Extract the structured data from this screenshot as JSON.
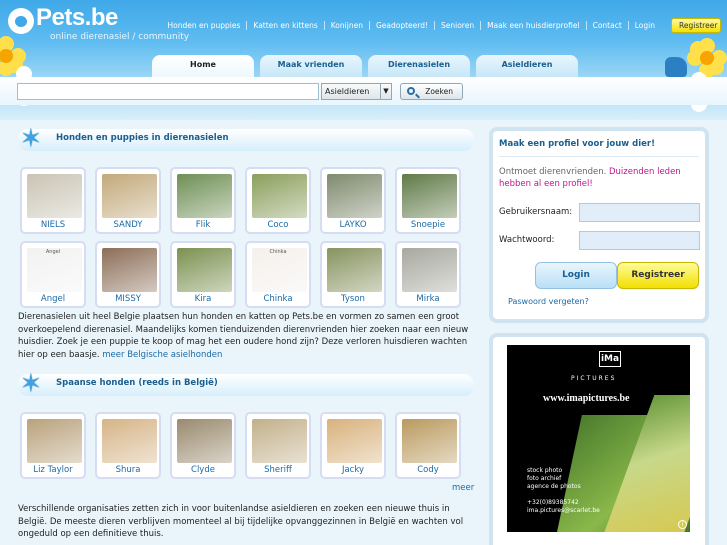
{
  "brand": {
    "name": "Pets.be",
    "tagline": "online dierenasiel / community"
  },
  "topnav": {
    "links": [
      "Honden en puppies",
      "Katten en kittens",
      "Konijnen",
      "Geadopteerd!",
      "Senioren",
      "Maak een huisdierprofiel",
      "Contact",
      "Login"
    ],
    "register_label": "Registreer"
  },
  "tabs": [
    "Home",
    "Maak vrienden",
    "Dierenasielen",
    "Asieldieren"
  ],
  "search": {
    "value": "",
    "select_value": "Asieldieren",
    "button_label": "Zoeken"
  },
  "section1": {
    "title": "Honden en puppies in dierenasielen",
    "animals": [
      {
        "name": "NIELS",
        "color": "#c9c4b4"
      },
      {
        "name": "SANDY",
        "color": "#c2a97a"
      },
      {
        "name": "Flik",
        "color": "#6f8f55"
      },
      {
        "name": "Coco",
        "color": "#8a9f5c"
      },
      {
        "name": "LAYKO",
        "color": "#7f8a6e"
      },
      {
        "name": "Snoepie",
        "color": "#5f7a47"
      },
      {
        "name": "Angel",
        "color": "#f2f2f2"
      },
      {
        "name": "MISSY",
        "color": "#8c6e58"
      },
      {
        "name": "Kira",
        "color": "#7b9150"
      },
      {
        "name": "Chinka",
        "color": "#f4f0ec"
      },
      {
        "name": "Tyson",
        "color": "#87935f"
      },
      {
        "name": "Mirka",
        "color": "#a8a8a0"
      }
    ],
    "caption_angel": "Angel",
    "caption_chinka": "Chinka",
    "paragraph": "Dierenasielen uit heel Belgie plaatsen hun honden en katten op Pets.be en vormen zo samen een groot overkoepelend dierenasiel. Maandelijks komen tienduizenden dierenvrienden hier zoeken naar een nieuw huisdier. Zoek je een puppie te koop of mag het een oudere hond zijn? Deze verloren huisdieren wachten hier op een baasje.",
    "more_link": "meer Belgische asielhonden"
  },
  "section2": {
    "title": "Spaanse honden (reeds in België)",
    "animals": [
      {
        "name": "Liz Taylor",
        "color": "#b9a27c"
      },
      {
        "name": "Shura",
        "color": "#d6b486"
      },
      {
        "name": "Clyde",
        "color": "#9a8a6e"
      },
      {
        "name": "Sheriff",
        "color": "#c2b08a"
      },
      {
        "name": "Jacky",
        "color": "#d8b27c"
      },
      {
        "name": "Cody",
        "color": "#b99a5e"
      }
    ],
    "more_link": "meer",
    "paragraph": "Verschillende organisaties zetten zich in voor buitenlandse asieldieren en zoeken een nieuwe thuis in België. De meeste dieren verblijven momenteel al bij tijdelijke opvanggezinnen in België en wachten vol ongeduld op een definitieve thuis."
  },
  "login": {
    "title": "Maak een profiel voor jouw dier!",
    "intro_prefix": "Ontmoet dierenvrienden.",
    "intro_link": "Duizenden leden hebben al een profiel!",
    "username_label": "Gebruikersnaam:",
    "password_label": "Wachtwoord:",
    "login_button": "Login",
    "register_button": "Registreer",
    "forgot_link": "Paswoord vergeten?"
  },
  "ad": {
    "logo": "iMa",
    "brand": "PICTURES",
    "url": "www.imapictures.be",
    "lines": "stock photo\nfoto archief\nagence de photos\n\n+32(0)89385742\nima.pictures@scarlet.be",
    "info": "i"
  }
}
